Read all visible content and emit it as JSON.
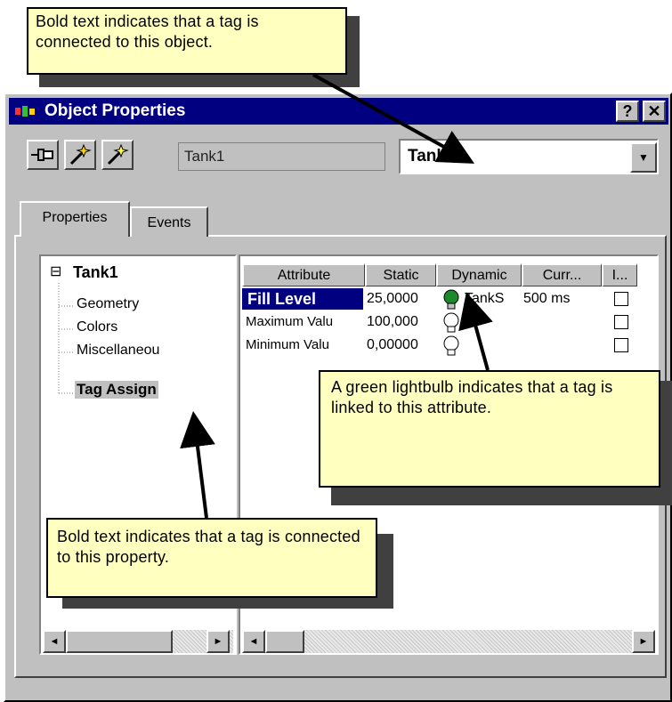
{
  "window": {
    "title": "Object Properties",
    "help_btn": "?",
    "close_btn": "✕"
  },
  "toolbar": {
    "pin_icon": "pin-icon",
    "wand_icon": "magic-wand-icon",
    "wand2_icon": "magic-wand-yellow-icon",
    "object_name": "Tank1",
    "combo_value": "Tank1",
    "combo_arrow": "▼"
  },
  "tabs": [
    {
      "label": "Properties"
    },
    {
      "label": "Events"
    }
  ],
  "tree": {
    "expander": "⊟",
    "root": "Tank1",
    "items": [
      "Geometry",
      "Colors",
      "Miscellaneou",
      "Tag Assign"
    ]
  },
  "grid": {
    "headers": [
      "Attribute",
      "Static",
      "Dynamic",
      "Curr...",
      "I..."
    ],
    "rows": [
      {
        "attribute": "Fill Level",
        "static": "25,0000",
        "dynamic": "TankS",
        "current": "500 ms",
        "bulb": "green-lightbulb-icon"
      },
      {
        "attribute": "Maximum Valu",
        "static": "100,000",
        "dynamic": "",
        "current": "",
        "bulb": "lightbulb-icon"
      },
      {
        "attribute": "Minimum Valu",
        "static": "0,00000",
        "dynamic": "",
        "current": "",
        "bulb": "lightbulb-icon"
      }
    ]
  },
  "scrollbar": {
    "left": "◄",
    "right": "►"
  },
  "callouts": {
    "top": "Bold text indicates that a tag is connected to this object.",
    "bulb": "A green lightbulb indicates that a tag is linked to this attribute.",
    "bottom": "Bold text indicates that a tag is connected to this property."
  },
  "colors": {
    "titlebar": "#000080",
    "callout": "#ffffc0",
    "dialog": "#c0c0c0",
    "selected_cell": "#000080",
    "bulb_green": "#1a8a2a"
  }
}
